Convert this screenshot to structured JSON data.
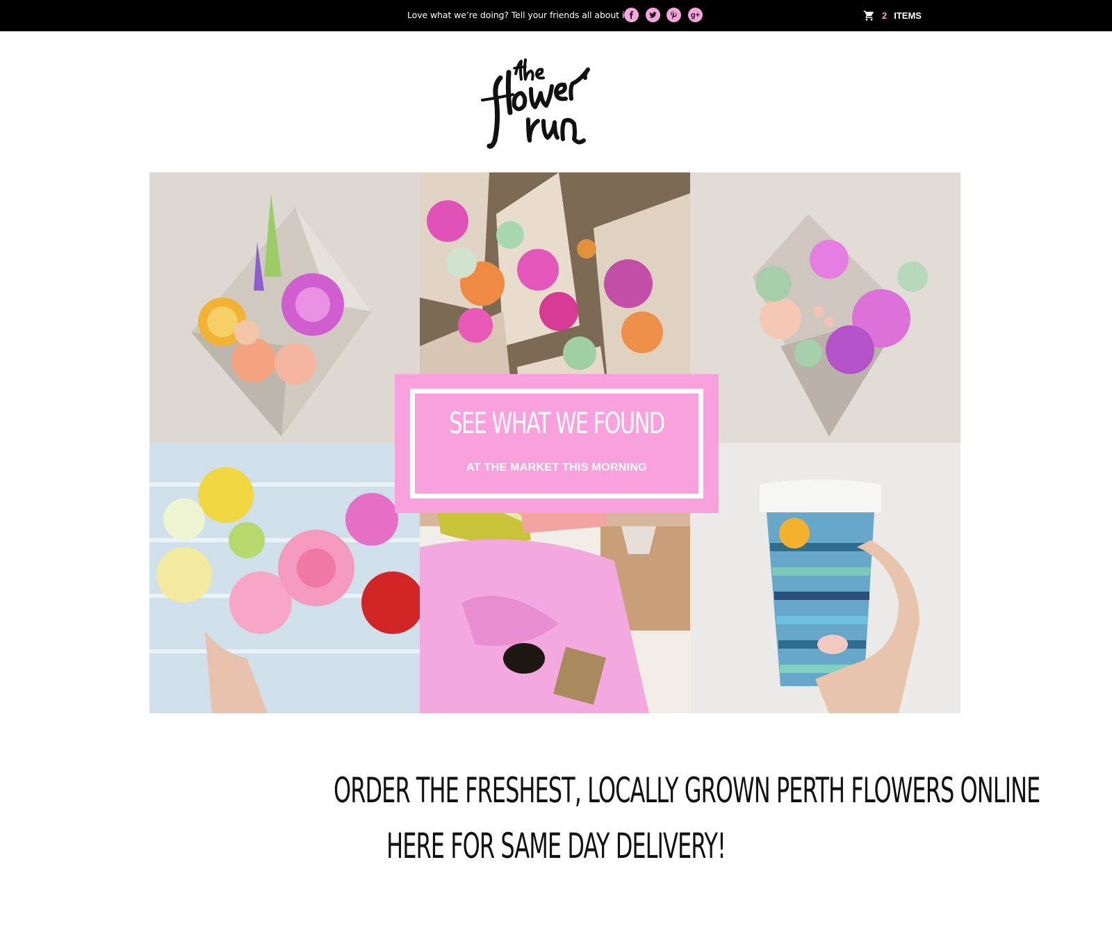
{
  "topbar": {
    "share_message": "Love what we’re doing?  Tell your friends all about it!",
    "social": [
      {
        "icon": "facebook-icon",
        "glyph": "f"
      },
      {
        "icon": "twitter-icon",
        "glyph": ""
      },
      {
        "icon": "pinterest-icon",
        "glyph": "P"
      },
      {
        "icon": "google-plus-icon",
        "glyph": "g+"
      }
    ],
    "cart": {
      "count": "2",
      "label": "ITEMS"
    }
  },
  "logo": {
    "text": "the flower run"
  },
  "banner": {
    "title": "SEE WHAT WE FOUND",
    "subtitle": "AT THE MARKET THIS MORNING"
  },
  "headline": {
    "line1": "ORDER THE FRESHEST, LOCALLY GROWN PERTH FLOWERS ONLINE",
    "line2": "HERE FOR SAME DAY DELIVERY!"
  },
  "colors": {
    "accent_pink": "#f8a1dc",
    "topbar_bg": "#000000"
  }
}
